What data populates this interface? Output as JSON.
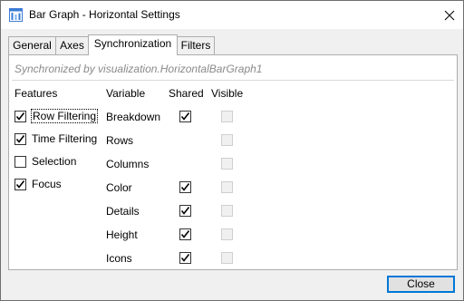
{
  "window": {
    "title": "Bar Graph - Horizontal Settings",
    "app_icon": "bar-graph-window-icon",
    "close_icon": "close-icon"
  },
  "tabs": [
    {
      "label": "General",
      "active": false
    },
    {
      "label": "Axes",
      "active": false
    },
    {
      "label": "Synchronization",
      "active": true
    },
    {
      "label": "Filters",
      "active": false
    }
  ],
  "panel": {
    "sync_note": "Synchronized by visualization.HorizontalBarGraph1",
    "headers": {
      "features": "Features",
      "variable": "Variable",
      "shared": "Shared",
      "visible": "Visible"
    },
    "features": [
      {
        "label": "Row Filtering",
        "checked": true,
        "focused": true
      },
      {
        "label": "Time Filtering",
        "checked": true,
        "focused": false
      },
      {
        "label": "Selection",
        "checked": false,
        "focused": false
      },
      {
        "label": "Focus",
        "checked": true,
        "focused": false
      }
    ],
    "variables": [
      {
        "label": "Breakdown",
        "shared": true,
        "visible": false
      },
      {
        "label": "Rows",
        "shared": null,
        "visible": false
      },
      {
        "label": "Columns",
        "shared": null,
        "visible": false
      },
      {
        "label": "Color",
        "shared": true,
        "visible": false
      },
      {
        "label": "Details",
        "shared": true,
        "visible": false
      },
      {
        "label": "Height",
        "shared": true,
        "visible": false
      },
      {
        "label": "Icons",
        "shared": true,
        "visible": false
      }
    ]
  },
  "footer": {
    "close_label": "Close"
  },
  "colors": {
    "accent": "#0078d7",
    "note_text": "#8a8a8a",
    "disabled_checkbox": "#cfcfcf"
  }
}
